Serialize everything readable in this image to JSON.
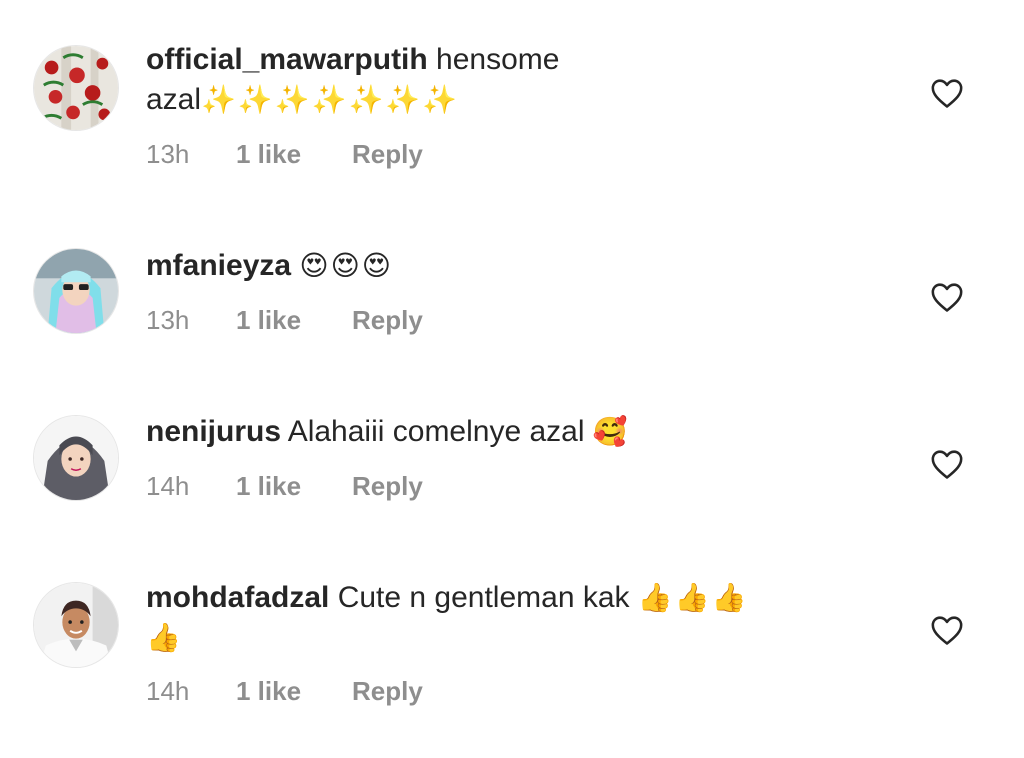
{
  "comments": [
    {
      "username": "official_mawarputih",
      "text": " hensome",
      "text_line2": "azal",
      "emoji": "✨✨✨✨✨✨✨",
      "time": "13h",
      "likes": "1 like",
      "reply": "Reply",
      "like_icon": "heart-outline-icon",
      "avatar_colors": [
        "#e9e6df",
        "#b71c1c",
        "#2e7d32"
      ]
    },
    {
      "username": "mfanieyza",
      "text": "",
      "emoji": "😍😍😍",
      "time": "13h",
      "likes": "1 like",
      "reply": "Reply",
      "like_icon": "heart-outline-icon",
      "avatar_colors": [
        "#cfd8dc",
        "#80deea",
        "#e1bee7"
      ]
    },
    {
      "username": "nenijurus",
      "text": " Alahaiii comelnye azal ",
      "emoji": "🥰",
      "time": "14h",
      "likes": "1 like",
      "reply": "Reply",
      "like_icon": "heart-outline-icon",
      "avatar_colors": [
        "#f5f5f5",
        "#5d5d66",
        "#f3d4bf"
      ]
    },
    {
      "username": "mohdafadzal",
      "text": " Cute n gentleman kak ",
      "emoji": "👍👍👍",
      "emoji_line2": "👍",
      "time": "14h",
      "likes": "1 like",
      "reply": "Reply",
      "like_icon": "heart-outline-icon",
      "avatar_colors": [
        "#f2f2f2",
        "#3e2723",
        "#c68a62"
      ]
    }
  ],
  "colors": {
    "primary_text": "#262626",
    "secondary_text": "#8e8e8e",
    "heart_outline": "#262626"
  }
}
